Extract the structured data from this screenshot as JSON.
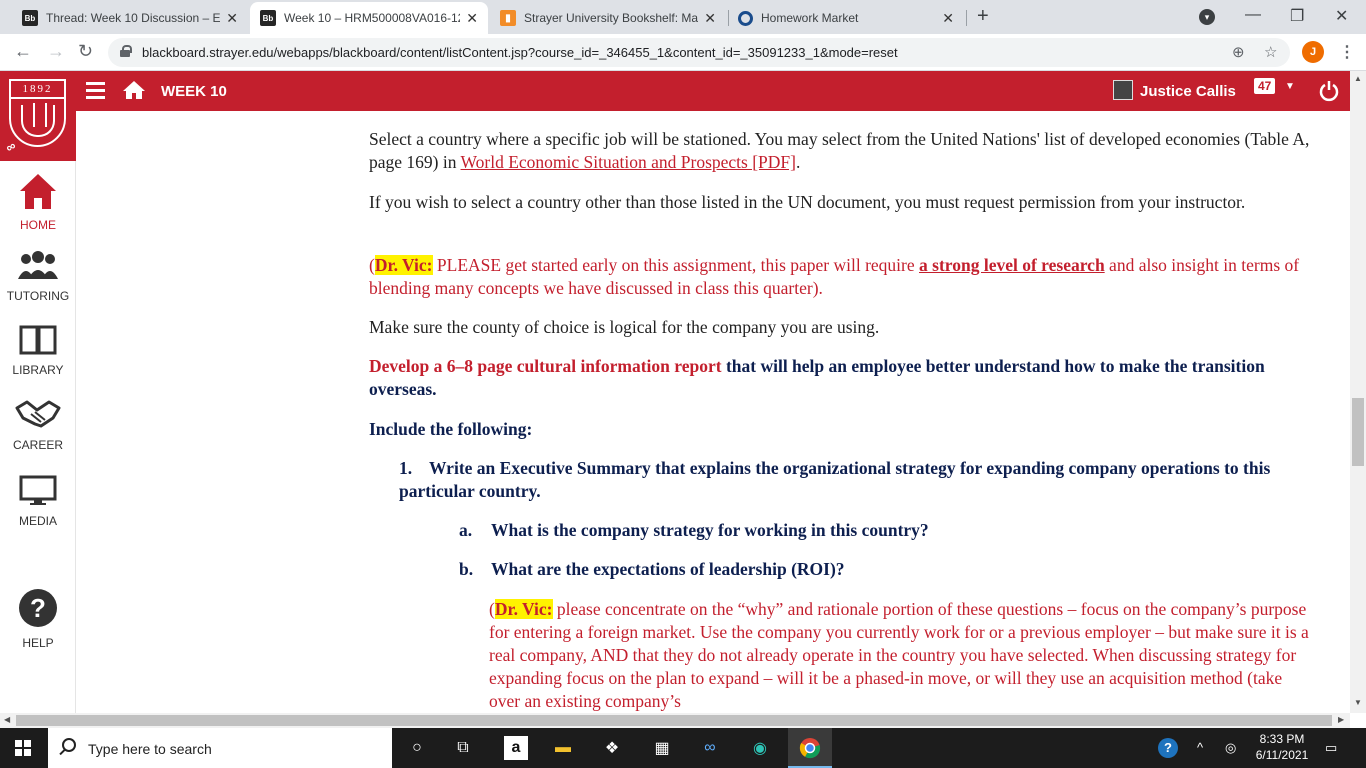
{
  "browser": {
    "tabs": [
      {
        "title": "Thread: Week 10 Discussion – EC",
        "favicon": "Bb",
        "active": false
      },
      {
        "title": "Week 10 – HRM500008VA016-12",
        "favicon": "Bb",
        "active": true
      },
      {
        "title": "Strayer University Bookshelf: Mar",
        "favicon": "bookshelf",
        "active": false
      },
      {
        "title": "Homework Market",
        "favicon": "homework-market",
        "active": false
      }
    ],
    "url": "blackboard.strayer.edu/webapps/blackboard/content/listContent.jsp?course_id=_346455_1&content_id=_35091233_1&mode=reset",
    "profile_initial": "J"
  },
  "header": {
    "week_title": "WEEK 10",
    "user_name": "Justice Callis",
    "notification_count": "47",
    "accent_color": "#c31f2d"
  },
  "sidebar": {
    "logo_year": "1892",
    "items": [
      {
        "label": "HOME",
        "icon": "home-icon"
      },
      {
        "label": "TUTORING",
        "icon": "people-icon"
      },
      {
        "label": "LIBRARY",
        "icon": "book-icon"
      },
      {
        "label": "CAREER",
        "icon": "handshake-icon"
      },
      {
        "label": "MEDIA",
        "icon": "monitor-icon"
      },
      {
        "label": "HELP",
        "icon": "question-icon"
      }
    ]
  },
  "content": {
    "p1_text": "Select a country where a specific job will be stationed. You may select from the United Nations' list of developed economies (Table A, page 169) in ",
    "p1_link": "World Economic Situation and Prospects [PDF]",
    "p1_end": ".",
    "p2_text": "If you wish to select a country other than those listed in the UN document, you must request permission from your instructor.",
    "p3_open": "(",
    "p3_highlight": "Dr. Vic:",
    "p3_text": " PLEASE get started early on this assignment, this paper will require ",
    "p3_link": "a strong level of research",
    "p3_end": " and also insight in terms of blending many concepts we have discussed in class this quarter).",
    "p4_text": "Make sure the county of choice is logical for the company you are using.",
    "p5_red": "Develop a 6–8 page cultural information report",
    "p5_navy": " that will help an employee better understand how to make the transition overseas.",
    "p6_text": "Include the following:",
    "item1_num": "1.",
    "item1_text": "Write an Executive Summary that explains the organizational strategy for expanding company operations to this particular country.",
    "sub_a_num": "a.",
    "sub_a_text": "What is the company strategy for working in this country?",
    "sub_b_num": "b.",
    "sub_b_text": "What are the expectations of leadership (ROI)?",
    "p7_open": "(",
    "p7_highlight": "Dr. Vic:",
    "p7_text": " please concentrate on the “why” and rationale portion of these questions – focus on the company’s purpose for entering a foreign market. Use the company you currently work for or a previous employer – but make sure it is a real company, AND that they do not already operate in the country you have selected. When discussing strategy for expanding focus on the plan to expand – will it be a phased-in move, or will they use an acquisition method (take over an existing company’s"
  },
  "taskbar": {
    "search_placeholder": "Type here to search",
    "time": "8:33 PM",
    "date": "6/11/2021"
  }
}
